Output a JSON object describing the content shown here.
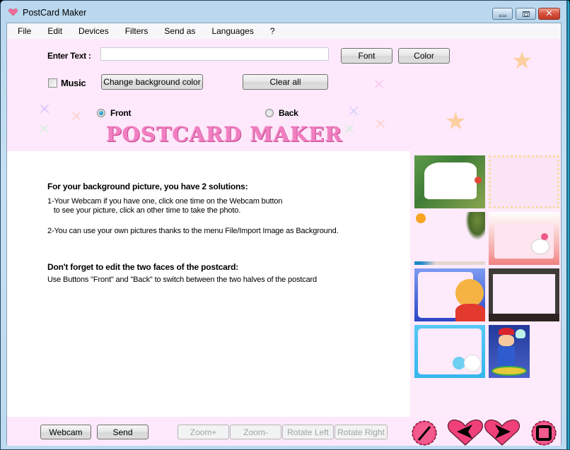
{
  "window": {
    "title": "PostCard Maker",
    "icon": "heart-icon",
    "controls": [
      "minimize",
      "maximize",
      "close"
    ],
    "close_glyph": "✕"
  },
  "menu": {
    "items": [
      {
        "label": "File"
      },
      {
        "label": "Edit"
      },
      {
        "label": "Devices"
      },
      {
        "label": "Filters"
      },
      {
        "label": "Send as"
      },
      {
        "label": "Languages"
      },
      {
        "label": "?"
      }
    ]
  },
  "controls": {
    "enter_text_label": "Enter Text :",
    "enter_text_value": "",
    "font_button": "Font",
    "color_button": "Color",
    "music_label": "Music",
    "music_checked": false,
    "change_bg_button": "Change background color",
    "clear_all_button": "Clear all",
    "front_label": "Front",
    "back_label": "Back",
    "selected_side": "Front"
  },
  "banner": {
    "title": "POSTCARD MAKER",
    "accent_color": "#f07ec0"
  },
  "instructions": {
    "heading1": "For your background picture, you have 2 solutions:",
    "line1a": "1-Your Webcam if you have one, click one time on the Webcam button",
    "line1b": "   to see your picture, click an other time to take the photo.",
    "line2": "2-You can use your own pictures thanks to the menu File/Import Image as Background.",
    "heading2": "Don't forget to edit the two faces of the postcard:",
    "line3": "Use Buttons \"Front\" and \"Back\" to switch between the two halves of the postcard"
  },
  "frames": [
    {
      "name": "jungle-frame"
    },
    {
      "name": "pastel-stars-frame"
    },
    {
      "name": "beach-sun-palm-frame"
    },
    {
      "name": "hello-kitty-frame"
    },
    {
      "name": "winnie-the-pooh-frame"
    },
    {
      "name": "rocky-halloween-frame"
    },
    {
      "name": "cute-sheep-frame"
    },
    {
      "name": "mario-frame"
    }
  ],
  "bottom": {
    "webcam_button": "Webcam",
    "send_button": "Send",
    "zoom_in_button": "Zoom+",
    "zoom_out_button": "Zoom-",
    "rotate_left_button": "Rotate Left",
    "rotate_right_button": "Rotate Right",
    "nav_buttons": [
      "draw-tool",
      "previous",
      "next",
      "stop"
    ]
  }
}
